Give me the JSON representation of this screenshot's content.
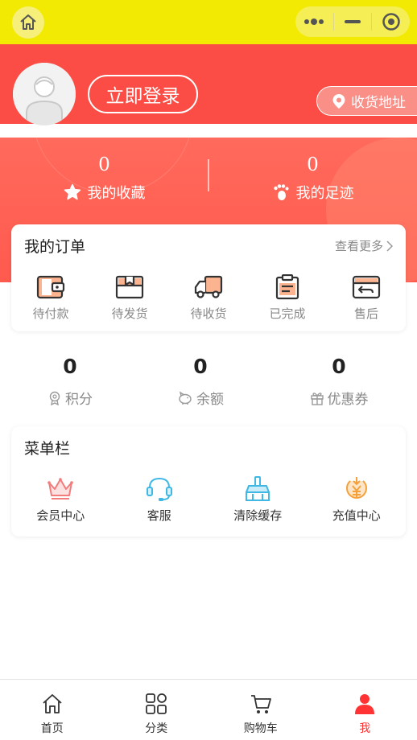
{
  "topbar": {
    "home_icon": "home-icon",
    "menu_icon": "more-dots-icon",
    "minimize_icon": "minimize-icon",
    "close_icon": "target-icon",
    "bg": "#f2ea02"
  },
  "header": {
    "login_label": "立即登录",
    "address_label": "收货地址",
    "accent": "#fb4d45"
  },
  "stats": [
    {
      "value": "0",
      "label": "我的收藏",
      "icon": "star-icon"
    },
    {
      "value": "0",
      "label": "我的足迹",
      "icon": "footprint-icon"
    }
  ],
  "orders": {
    "title": "我的订单",
    "more": "查看更多",
    "items": [
      {
        "label": "待付款",
        "icon": "wallet-icon"
      },
      {
        "label": "待发货",
        "icon": "box-icon"
      },
      {
        "label": "待收货",
        "icon": "truck-icon"
      },
      {
        "label": "已完成",
        "icon": "clipboard-icon"
      },
      {
        "label": "售后",
        "icon": "return-icon"
      }
    ]
  },
  "points": [
    {
      "value": "0",
      "label": "积分",
      "icon": "medal-icon"
    },
    {
      "value": "0",
      "label": "余额",
      "icon": "piggy-icon"
    },
    {
      "value": "0",
      "label": "优惠券",
      "icon": "gift-icon"
    }
  ],
  "menu": {
    "title": "菜单栏",
    "items": [
      {
        "label": "会员中心",
        "icon": "crown-icon"
      },
      {
        "label": "客服",
        "icon": "headset-icon"
      },
      {
        "label": "清除缓存",
        "icon": "broom-icon"
      },
      {
        "label": "充值中心",
        "icon": "yen-coin-icon"
      }
    ]
  },
  "tabs": [
    {
      "label": "首页",
      "icon": "home-icon"
    },
    {
      "label": "分类",
      "icon": "category-icon"
    },
    {
      "label": "购物车",
      "icon": "cart-icon"
    },
    {
      "label": "我",
      "icon": "user-icon",
      "active": true
    }
  ]
}
